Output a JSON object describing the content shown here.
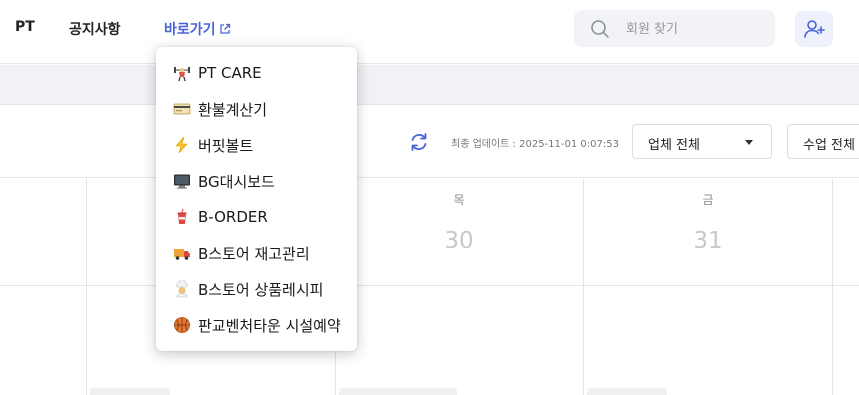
{
  "nav": {
    "pt": "PT",
    "notice": "공지사항",
    "shortcut": "바로가기"
  },
  "search": {
    "placeholder": "회원 찾기",
    "value": ""
  },
  "toolbar": {
    "updated": "최종 업데이트 : 2025-11-01 0:07:53",
    "company_select": "업체 전체",
    "class_select": "수업 전체"
  },
  "calendar": {
    "days": [
      {
        "name": "",
        "num": ""
      },
      {
        "name": "목",
        "num": "30"
      },
      {
        "name": "금",
        "num": "31"
      }
    ]
  },
  "shortcut_menu": [
    {
      "label": "PT CARE",
      "icon": "weightlifter-icon"
    },
    {
      "label": "환불계산기",
      "icon": "credit-card-icon"
    },
    {
      "label": "버핏볼트",
      "icon": "lightning-icon"
    },
    {
      "label": "BG대시보드",
      "icon": "desktop-icon"
    },
    {
      "label": "B-ORDER",
      "icon": "drink-cup-icon"
    },
    {
      "label": "B스토어 재고관리",
      "icon": "delivery-truck-icon"
    },
    {
      "label": "B스토어 상품레시피",
      "icon": "chef-icon"
    },
    {
      "label": "판교벤처타운 시설예약",
      "icon": "basketball-icon"
    }
  ],
  "colors": {
    "accent": "#4a63d8",
    "muted": "#c8c8cc"
  }
}
